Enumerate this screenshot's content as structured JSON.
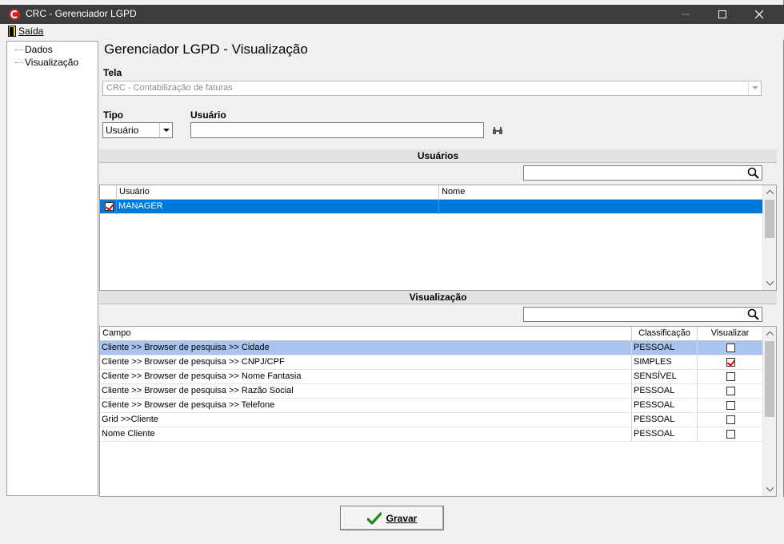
{
  "window": {
    "title": "CRC - Gerenciador LGPD"
  },
  "menu": {
    "exit_label": "Saída"
  },
  "tree": {
    "items": [
      "Dados",
      "Visualização"
    ]
  },
  "page": {
    "title": "Gerenciador LGPD - Visualização"
  },
  "form": {
    "tela_label": "Tela",
    "tela_value": "CRC - Contabilização de faturas",
    "tipo_label": "Tipo",
    "tipo_value": "Usuário",
    "usuario_label": "Usuário",
    "usuario_value": ""
  },
  "users_section": {
    "title": "Usuários",
    "search_value": "",
    "columns": [
      "Usuário",
      "Nome"
    ],
    "rows": [
      {
        "checked": true,
        "usuario": "MANAGER",
        "nome": "",
        "selected": true
      }
    ]
  },
  "view_section": {
    "title": "Visualização",
    "search_value": "",
    "columns": [
      "Campo",
      "Classificação",
      "Visualizar"
    ],
    "rows": [
      {
        "campo": "Cliente >> Browser de pesquisa >> Cidade",
        "classificacao": "PESSOAL",
        "visualizar": false,
        "selected": true
      },
      {
        "campo": "Cliente >> Browser de pesquisa >> CNPJ/CPF",
        "classificacao": "SIMPLES",
        "visualizar": true,
        "selected": false
      },
      {
        "campo": "Cliente >> Browser de pesquisa >> Nome Fantasia",
        "classificacao": "SENSÍVEL",
        "visualizar": false,
        "selected": false
      },
      {
        "campo": "Cliente >> Browser de pesquisa >> Razão Social",
        "classificacao": "PESSOAL",
        "visualizar": false,
        "selected": false
      },
      {
        "campo": "Cliente >> Browser de pesquisa >> Telefone",
        "classificacao": "PESSOAL",
        "visualizar": false,
        "selected": false
      },
      {
        "campo": "Grid >>Cliente",
        "classificacao": "PESSOAL",
        "visualizar": false,
        "selected": false
      },
      {
        "campo": "Nome Cliente",
        "classificacao": "PESSOAL",
        "visualizar": false,
        "selected": false
      }
    ]
  },
  "footer": {
    "save_label": "Gravar"
  },
  "colors": {
    "selection_blue": "#0078d7",
    "selection_light": "#a9c4ee",
    "titlebar": "#3c3c3c"
  }
}
